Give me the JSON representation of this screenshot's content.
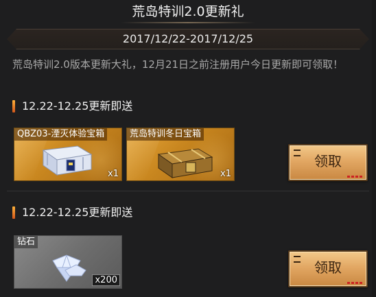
{
  "header": {
    "title": "荒岛特训2.0更新礼"
  },
  "event": {
    "date_range": "2017/12/22-2017/12/25",
    "description": "荒岛特训2.0版本更新大礼，12月21日之前注册用户今日更新即可领取！"
  },
  "sections": [
    {
      "heading": "12.22-12.25更新即送",
      "items": [
        {
          "name": "QBZ03-湮灭体验宝箱",
          "quantity": "x1",
          "icon": "weapon-crate-icon"
        },
        {
          "name": "荒岛特训冬日宝箱",
          "quantity": "x1",
          "icon": "treasure-chest-icon"
        }
      ],
      "button_label": "领取"
    },
    {
      "heading": "12.22-12.25更新即送",
      "items": [
        {
          "name": "钻石",
          "quantity": "x200",
          "icon": "diamond-icon"
        }
      ],
      "button_label": "领取"
    }
  ],
  "colors": {
    "accent": "#e2a763",
    "heading_bar": "#ff8a2a",
    "background": "#1e1e1f"
  }
}
